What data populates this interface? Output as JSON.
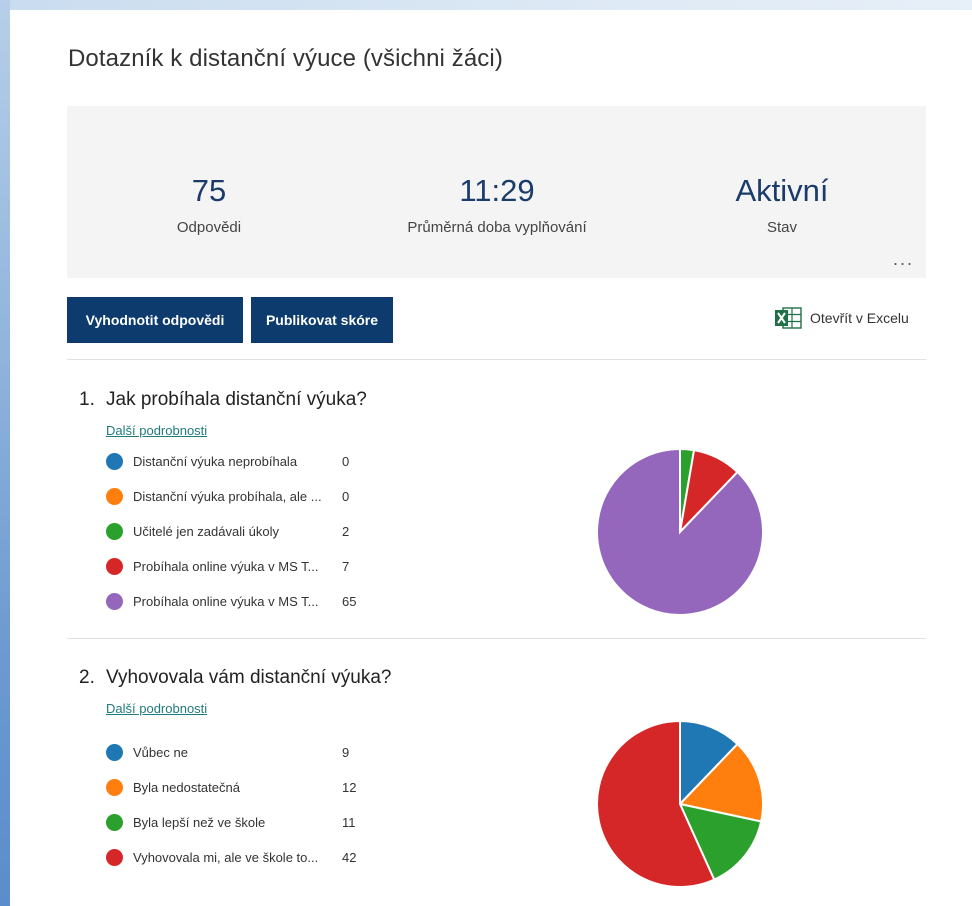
{
  "form": {
    "title": "Dotazník k distanční výuce (všichni žáci)",
    "more_label": "..."
  },
  "stats": [
    {
      "value": "75",
      "label": "Odpovědi"
    },
    {
      "value": "11:29",
      "label": "Průměrná doba vyplňování"
    },
    {
      "value": "Aktivní",
      "label": "Stav"
    }
  ],
  "actions": {
    "review_label": "Vyhodnotit odpovědi",
    "publish_label": "Publikovat skóre",
    "excel_label": "Otevřít v Excelu"
  },
  "questions": [
    {
      "number": "1.",
      "title": "Jak probíhala distanční výuka?",
      "details_label": "Další podrobnosti",
      "options": [
        {
          "label": "Distanční výuka neprobíhala",
          "count": 0,
          "color": "#1f77b4"
        },
        {
          "label": "Distanční výuka probíhala, ale ...",
          "count": 0,
          "color": "#ff7f0e"
        },
        {
          "label": "Učitelé jen zadávali úkoly",
          "count": 2,
          "color": "#2ca02c"
        },
        {
          "label": "Probíhala online výuka v MS T...",
          "count": 7,
          "color": "#d62728"
        },
        {
          "label": "Probíhala online výuka v MS T...",
          "count": 65,
          "color": "#9467bd"
        }
      ]
    },
    {
      "number": "2.",
      "title": "Vyhovovala vám distanční výuka?",
      "details_label": "Další podrobnosti",
      "options": [
        {
          "label": "Vůbec ne",
          "count": 9,
          "color": "#1f77b4"
        },
        {
          "label": "Byla nedostatečná",
          "count": 12,
          "color": "#ff7f0e"
        },
        {
          "label": "Byla lepší než ve škole",
          "count": 11,
          "color": "#2ca02c"
        },
        {
          "label": "Vyhovovala mi, ale ve škole to...",
          "count": 42,
          "color": "#d62728"
        }
      ]
    }
  ],
  "chart_data": [
    {
      "type": "pie",
      "categories": [
        "Distanční výuka neprobíhala",
        "Distanční výuka probíhala, ale ...",
        "Učitelé jen zadávali úkoly",
        "Probíhala online výuka v MS T...",
        "Probíhala online výuka v MS T..."
      ],
      "values": [
        0,
        0,
        2,
        7,
        65
      ]
    },
    {
      "type": "pie",
      "categories": [
        "Vůbec ne",
        "Byla nedostatečná",
        "Byla lepší než ve škole",
        "Vyhovovala mi, ale ve škole to..."
      ],
      "values": [
        9,
        12,
        11,
        42
      ]
    }
  ]
}
